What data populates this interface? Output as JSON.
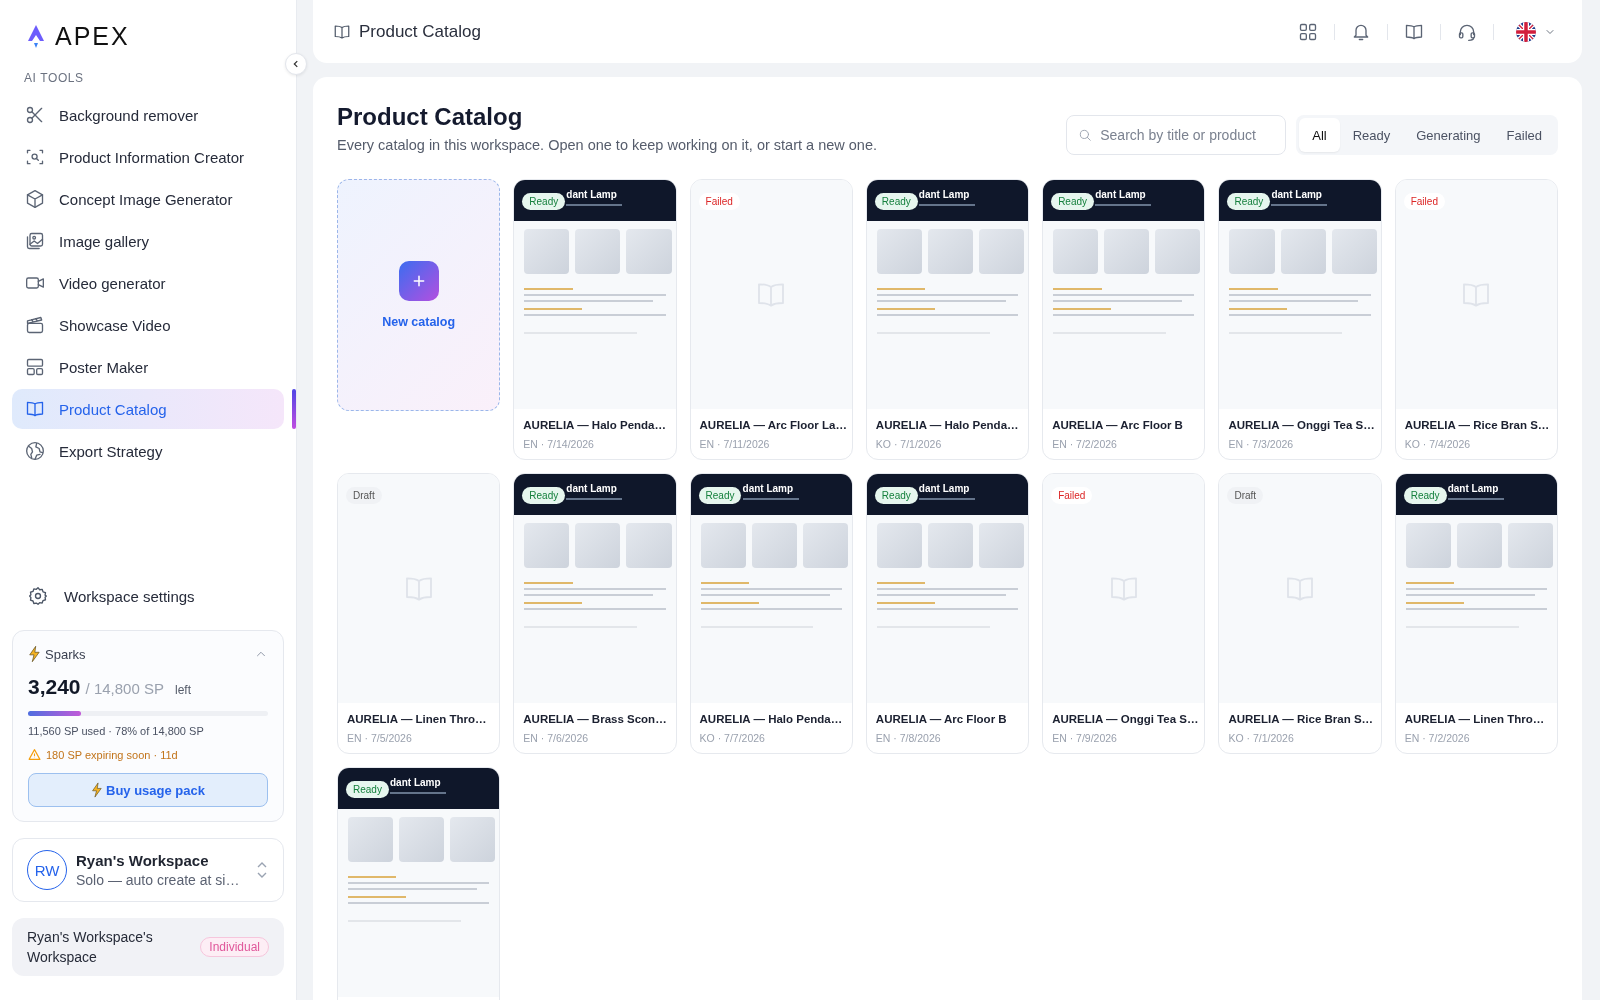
{
  "sidebar": {
    "logo": "APEX",
    "section_label": "AI TOOLS",
    "items": [
      {
        "label": "Background remover",
        "selected": false
      },
      {
        "label": "Product Information Creator",
        "selected": false
      },
      {
        "label": "Concept Image Generator",
        "selected": false
      },
      {
        "label": "Image gallery",
        "selected": false
      },
      {
        "label": "Video generator",
        "selected": false
      },
      {
        "label": "Showcase Video",
        "selected": false
      },
      {
        "label": "Poster Maker",
        "selected": false
      },
      {
        "label": "Product Catalog",
        "selected": true
      },
      {
        "label": "Export Strategy",
        "selected": false
      }
    ],
    "settings": "Workspace settings",
    "sparks": {
      "title": "Sparks",
      "amount": "3,240",
      "total": "/ 14,800 SP",
      "suffix": "left",
      "level": 0.22,
      "used": "11,560 SP used · 78% of 14,800 SP",
      "warning": "180 SP expiring soon · 11d",
      "button": "Buy usage pack"
    },
    "workspace": {
      "initials": "RW",
      "name": "Ryan's Workspace",
      "subtitle": "Solo — auto create at si…"
    },
    "account": {
      "name": "Ryan's Workspace's Workspace",
      "badge": "Individual"
    }
  },
  "header": {
    "title": "Product Catalog"
  },
  "page": {
    "title": "Product Catalog",
    "subtitle": "Every catalog in this workspace. Open one to keep working on it, or start a new one.",
    "search": {
      "placeholder": "Search by title or product"
    },
    "filters": [
      {
        "label": "All",
        "selected": true
      },
      {
        "label": "Ready",
        "selected": false
      },
      {
        "label": "Generating",
        "selected": false
      },
      {
        "label": "Failed",
        "selected": false
      }
    ]
  },
  "cards": [
    {
      "kind": "new",
      "label": "New catalog"
    },
    {
      "kind": "ready",
      "badge": "Ready",
      "title": "AURELIA — Halo Penda…",
      "meta": "EN · 7/14/2026",
      "preview": {
        "heading": "dant Lamp"
      }
    },
    {
      "kind": "failed",
      "badge": "Failed",
      "title": "AURELIA — Arc Floor La…",
      "meta": "EN · 7/11/2026"
    },
    {
      "kind": "ready",
      "badge": "Ready",
      "title": "AURELIA — Halo Penda…",
      "meta": "KO · 7/1/2026",
      "preview": {
        "heading": "dant Lamp"
      }
    },
    {
      "kind": "ready",
      "badge": "Ready",
      "title": "AURELIA — Arc Floor B",
      "meta": "EN · 7/2/2026",
      "preview": {
        "heading": "dant Lamp"
      }
    },
    {
      "kind": "ready",
      "badge": "Ready",
      "title": "AURELIA — Onggi Tea S…",
      "meta": "EN · 7/3/2026",
      "preview": {
        "heading": "dant Lamp"
      }
    },
    {
      "kind": "failed",
      "badge": "Failed",
      "title": "AURELIA — Rice Bran S…",
      "meta": "KO · 7/4/2026"
    },
    {
      "kind": "draft",
      "badge": "Draft",
      "title": "AURELIA — Linen Thro…",
      "meta": "EN · 7/5/2026"
    },
    {
      "kind": "ready",
      "badge": "Ready",
      "title": "AURELIA — Brass Scon…",
      "meta": "EN · 7/6/2026",
      "preview": {
        "heading": "dant Lamp"
      }
    },
    {
      "kind": "ready",
      "badge": "Ready",
      "title": "AURELIA — Halo Penda…",
      "meta": "KO · 7/7/2026",
      "preview": {
        "heading": "dant Lamp"
      }
    },
    {
      "kind": "ready",
      "badge": "Ready",
      "title": "AURELIA — Arc Floor B",
      "meta": "EN · 7/8/2026",
      "preview": {
        "heading": "dant Lamp"
      }
    },
    {
      "kind": "failed",
      "badge": "Failed",
      "title": "AURELIA — Onggi Tea S…",
      "meta": "EN · 7/9/2026"
    },
    {
      "kind": "draft",
      "badge": "Draft",
      "title": "AURELIA — Rice Bran S…",
      "meta": "KO · 7/1/2026"
    },
    {
      "kind": "ready",
      "badge": "Ready",
      "title": "AURELIA — Linen Thro…",
      "meta": "EN · 7/2/2026",
      "preview": {
        "heading": "dant Lamp"
      }
    },
    {
      "kind": "ready",
      "badge": "Ready",
      "preview": {
        "heading": "dant Lamp"
      }
    }
  ]
}
